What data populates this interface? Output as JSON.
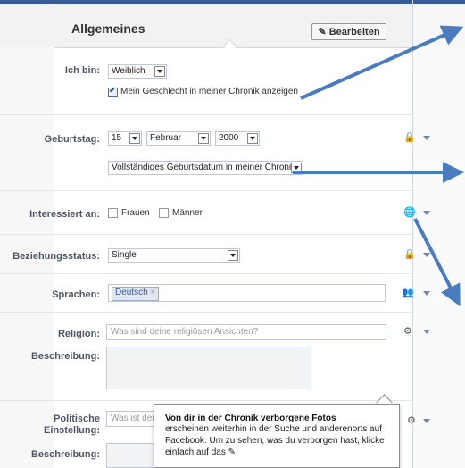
{
  "header": {
    "title": "Allgemeines",
    "edit_label": "Bearbeiten"
  },
  "fields": {
    "gender": {
      "label": "Ich bin:",
      "value": "Weiblich",
      "show_label": "Mein Geschlecht in meiner Chronik anzeigen"
    },
    "birthday": {
      "label": "Geburtstag:",
      "day": "15",
      "month": "Februar",
      "year": "2000",
      "display_option": "Vollständiges Geburtsdatum in meiner Chroni"
    },
    "interested": {
      "label": "Interessiert an:",
      "opt1": "Frauen",
      "opt2": "Männer"
    },
    "relationship": {
      "label": "Beziehungsstatus:",
      "value": "Single"
    },
    "languages": {
      "label": "Sprachen:",
      "token": "Deutsch"
    },
    "religion": {
      "label": "Religion:",
      "placeholder": "Was sind deine religiösen Ansichten?",
      "desc_label": "Beschreibung:"
    },
    "politics": {
      "label1": "Politische",
      "label2": "Einstellung:",
      "placeholder": "Was ist dein",
      "desc_label": "Beschreibung:"
    }
  },
  "tooltip": {
    "title": "Von dir in der Chronik verborgene Fotos",
    "line1": "erscheinen weiterhin in der Suche und anderenorts auf",
    "line2": "Facebook. Um zu sehen, was du verborgen hast, klicke",
    "line3": "einfach auf das"
  },
  "colors": {
    "accent": "#3b5998",
    "annotation_arrow": "#4a7cc0"
  }
}
